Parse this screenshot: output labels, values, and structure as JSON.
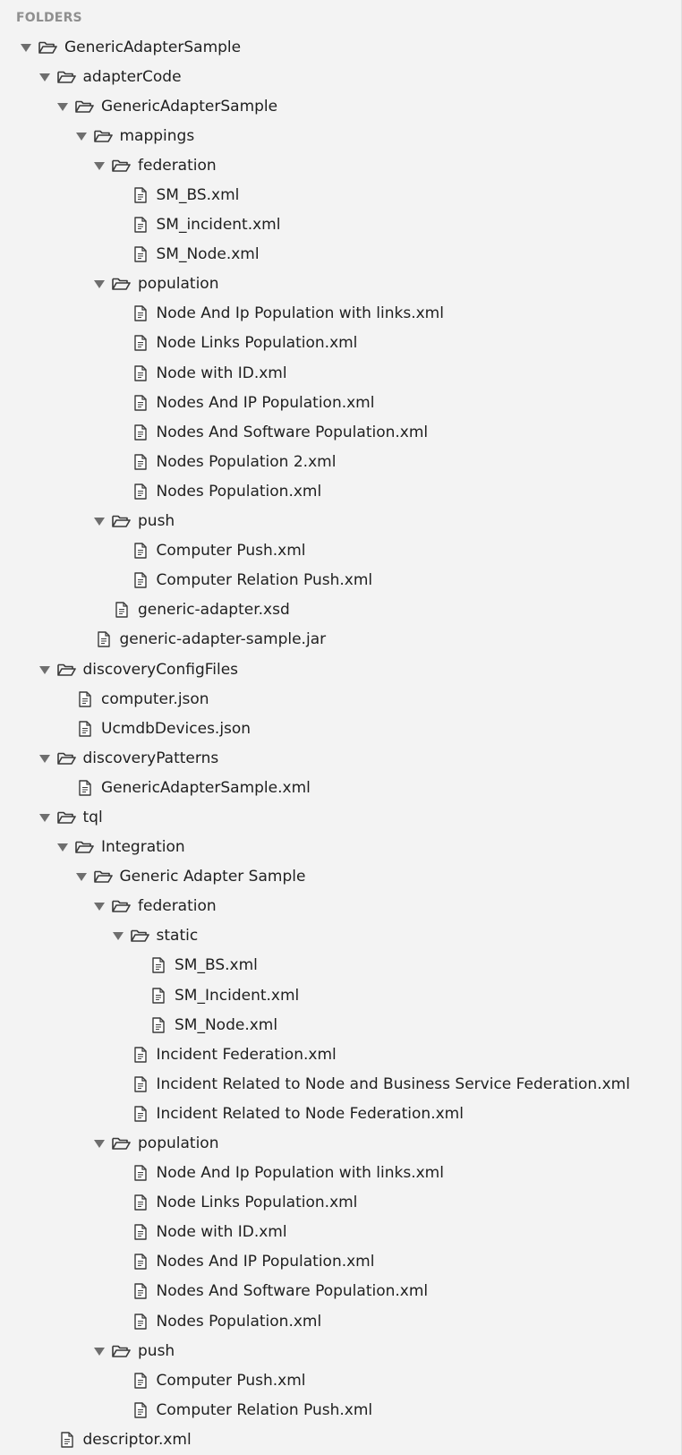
{
  "panel": {
    "header": "FOLDERS"
  },
  "tree": [
    {
      "label": "GenericAdapterSample",
      "type": "folder",
      "depth": 0,
      "expanded": true
    },
    {
      "label": "adapterCode",
      "type": "folder",
      "depth": 1,
      "expanded": true
    },
    {
      "label": "GenericAdapterSample",
      "type": "folder",
      "depth": 2,
      "expanded": true
    },
    {
      "label": "mappings",
      "type": "folder",
      "depth": 3,
      "expanded": true
    },
    {
      "label": "federation",
      "type": "folder",
      "depth": 4,
      "expanded": true
    },
    {
      "label": "SM_BS.xml",
      "type": "file",
      "depth": 5
    },
    {
      "label": "SM_incident.xml",
      "type": "file",
      "depth": 5
    },
    {
      "label": "SM_Node.xml",
      "type": "file",
      "depth": 5
    },
    {
      "label": "population",
      "type": "folder",
      "depth": 4,
      "expanded": true
    },
    {
      "label": "Node And Ip Population with links.xml",
      "type": "file",
      "depth": 5
    },
    {
      "label": "Node Links Population.xml",
      "type": "file",
      "depth": 5
    },
    {
      "label": "Node with ID.xml",
      "type": "file",
      "depth": 5
    },
    {
      "label": "Nodes And IP Population.xml",
      "type": "file",
      "depth": 5
    },
    {
      "label": "Nodes And Software Population.xml",
      "type": "file",
      "depth": 5
    },
    {
      "label": "Nodes Population 2.xml",
      "type": "file",
      "depth": 5
    },
    {
      "label": "Nodes Population.xml",
      "type": "file",
      "depth": 5
    },
    {
      "label": "push",
      "type": "folder",
      "depth": 4,
      "expanded": true
    },
    {
      "label": "Computer Push.xml",
      "type": "file",
      "depth": 5
    },
    {
      "label": "Computer Relation Push.xml",
      "type": "file",
      "depth": 5
    },
    {
      "label": "generic-adapter.xsd",
      "type": "file",
      "depth": 4
    },
    {
      "label": "generic-adapter-sample.jar",
      "type": "file",
      "depth": 3
    },
    {
      "label": "discoveryConfigFiles",
      "type": "folder",
      "depth": 1,
      "expanded": true
    },
    {
      "label": "computer.json",
      "type": "file",
      "depth": 2
    },
    {
      "label": "UcmdbDevices.json",
      "type": "file",
      "depth": 2
    },
    {
      "label": "discoveryPatterns",
      "type": "folder",
      "depth": 1,
      "expanded": true
    },
    {
      "label": "GenericAdapterSample.xml",
      "type": "file",
      "depth": 2
    },
    {
      "label": "tql",
      "type": "folder",
      "depth": 1,
      "expanded": true
    },
    {
      "label": "Integration",
      "type": "folder",
      "depth": 2,
      "expanded": true
    },
    {
      "label": "Generic Adapter Sample",
      "type": "folder",
      "depth": 3,
      "expanded": true
    },
    {
      "label": "federation",
      "type": "folder",
      "depth": 4,
      "expanded": true
    },
    {
      "label": "static",
      "type": "folder",
      "depth": 5,
      "expanded": true
    },
    {
      "label": "SM_BS.xml",
      "type": "file",
      "depth": 6
    },
    {
      "label": "SM_Incident.xml",
      "type": "file",
      "depth": 6
    },
    {
      "label": "SM_Node.xml",
      "type": "file",
      "depth": 6
    },
    {
      "label": "Incident Federation.xml",
      "type": "file",
      "depth": 5
    },
    {
      "label": "Incident Related to Node and Business Service Federation.xml",
      "type": "file",
      "depth": 5
    },
    {
      "label": "Incident Related to Node Federation.xml",
      "type": "file",
      "depth": 5
    },
    {
      "label": "population",
      "type": "folder",
      "depth": 4,
      "expanded": true
    },
    {
      "label": "Node And Ip Population with links.xml",
      "type": "file",
      "depth": 5
    },
    {
      "label": "Node Links Population.xml",
      "type": "file",
      "depth": 5
    },
    {
      "label": "Node with ID.xml",
      "type": "file",
      "depth": 5
    },
    {
      "label": "Nodes And IP Population.xml",
      "type": "file",
      "depth": 5
    },
    {
      "label": "Nodes And Software Population.xml",
      "type": "file",
      "depth": 5
    },
    {
      "label": "Nodes Population.xml",
      "type": "file",
      "depth": 5
    },
    {
      "label": "push",
      "type": "folder",
      "depth": 4,
      "expanded": true
    },
    {
      "label": "Computer Push.xml",
      "type": "file",
      "depth": 5
    },
    {
      "label": "Computer Relation Push.xml",
      "type": "file",
      "depth": 5
    },
    {
      "label": "descriptor.xml",
      "type": "file",
      "depth": 1
    }
  ],
  "icons": {
    "folder": "folder-open-icon",
    "file": "file-icon",
    "arrow": "chevron-down-icon"
  },
  "colors": {
    "background": "#f3f3f3",
    "header_text": "#8f8f8f",
    "item_text": "#1f1f1f",
    "icon_stroke": "#3a3a3a",
    "arrow": "#6e6e6e"
  }
}
